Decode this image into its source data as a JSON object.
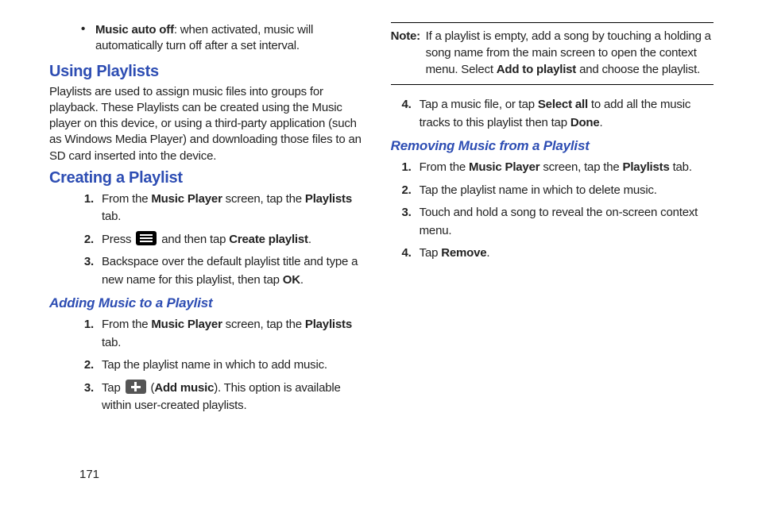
{
  "left": {
    "bullet": {
      "bold": "Music auto off",
      "rest": ": when activated, music will automatically turn off after a set interval."
    },
    "h2_using": "Using Playlists",
    "using_para": "Playlists are used to assign music files into groups for playback. These Playlists can be created using the Music player on this device, or using a third-party application (such as Windows Media Player) and downloading those files to an SD card inserted into the device.",
    "h2_creating": "Creating a Playlist",
    "creating_steps": {
      "s1_pre": "From the ",
      "s1_b1": "Music Player",
      "s1_mid": " screen, tap the ",
      "s1_b2": "Playlists",
      "s1_post": " tab.",
      "s2_pre": "Press ",
      "s2_mid": " and then tap ",
      "s2_b": "Create playlist",
      "s2_post": ".",
      "s3_pre": "Backspace over the default playlist title and type a new name for this playlist, then tap ",
      "s3_b": "OK",
      "s3_post": "."
    },
    "h3_adding": "Adding Music to a Playlist",
    "adding_steps": {
      "s1_pre": "From the ",
      "s1_b1": "Music Player",
      "s1_mid": " screen, tap the ",
      "s1_b2": "Playlists",
      "s1_post": " tab.",
      "s2": "Tap the playlist name in which to add music.",
      "s3_pre": "Tap ",
      "s3_paren_pre": " (",
      "s3_b": "Add music",
      "s3_paren_post": "). This option is available within user-created playlists."
    }
  },
  "right": {
    "note_label": "Note:",
    "note_pre": "If a playlist is empty, add a song by touching a holding a song name from the main screen to open the context menu. Select ",
    "note_b": "Add to playlist",
    "note_post": " and choose the playlist.",
    "s4_pre": "Tap a music file, or tap ",
    "s4_b1": "Select all",
    "s4_mid": " to add all the music tracks to this playlist then tap ",
    "s4_b2": "Done",
    "s4_post": ".",
    "h3_removing": "Removing Music from a Playlist",
    "removing_steps": {
      "s1_pre": "From the ",
      "s1_b1": "Music Player",
      "s1_mid": " screen, tap the ",
      "s1_b2": "Playlists",
      "s1_post": " tab.",
      "s2": "Tap the playlist name in which to delete music.",
      "s3": "Touch and hold a song to reveal the on-screen context menu.",
      "s4_pre": "Tap ",
      "s4_b": "Remove",
      "s4_post": "."
    }
  },
  "page_number": "171",
  "nums": {
    "n1": "1.",
    "n2": "2.",
    "n3": "3.",
    "n4": "4."
  }
}
